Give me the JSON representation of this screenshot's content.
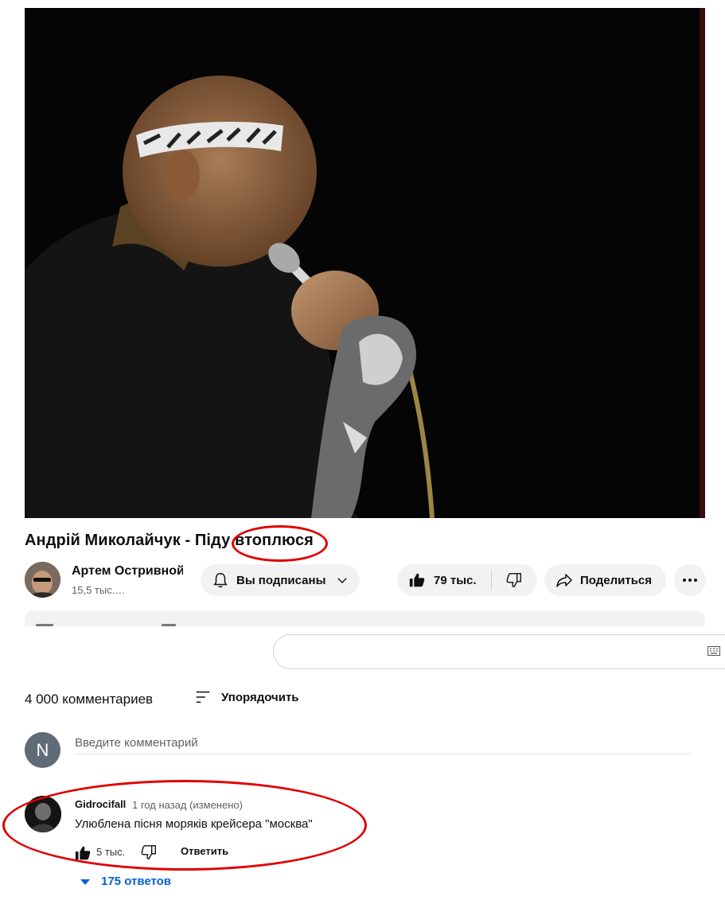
{
  "video": {
    "title_main": "Андрій Миколайчук - Піду ",
    "title_circled": "втоплюся"
  },
  "channel": {
    "name": "Артем Остривной",
    "subscribers": "15,5 тыс.…",
    "subscribe_label": "Вы подписаны"
  },
  "actions": {
    "likes": "79 тыс.",
    "share_label": "Поделиться"
  },
  "comments": {
    "count_label": "4 000 комментариев",
    "sort_label": "Упорядочить",
    "input_placeholder": "Введите комментарий",
    "user_initial": "N",
    "items": [
      {
        "author": "Gidrocifall",
        "time": "1 год назад (изменено)",
        "text": "Улюблена пісня моряків крейсера \"москва\"",
        "likes": "5 тыс.",
        "reply_label": "Ответить",
        "replies_label": "175 ответов"
      }
    ]
  },
  "colors": {
    "annotation": "#e00000",
    "link": "#065fd4",
    "pill_bg": "#f2f2f2"
  },
  "icons": [
    "bell-icon",
    "chevron-down-icon",
    "thumb-up-icon",
    "thumb-down-icon",
    "share-icon",
    "more-icon",
    "sort-icon",
    "keyboard-icon",
    "caret-down-icon"
  ]
}
